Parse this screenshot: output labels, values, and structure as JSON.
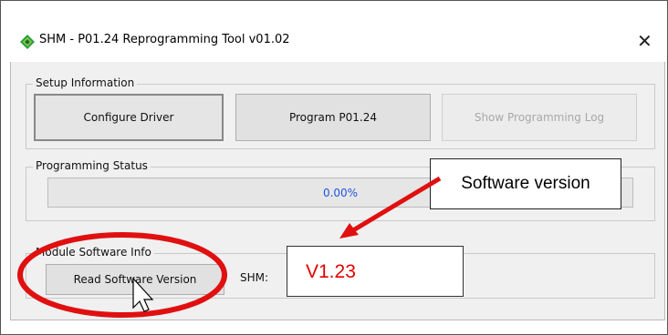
{
  "window": {
    "title": "SHM - P01.24 Reprogramming Tool v01.02",
    "close_glyph": "✕",
    "app_icon": "diamond-app-icon"
  },
  "setup": {
    "label": "Setup Information",
    "configure_label": "Configure Driver",
    "program_label": "Program P01.24",
    "show_log_label": "Show Programming Log"
  },
  "status": {
    "label": "Programming Status",
    "progress_text": "0.00%",
    "progress_fraction": 0
  },
  "module": {
    "label": "Module Software Info",
    "read_label": "Read Software Version",
    "shm_label": "SHM:",
    "value": "V1.23"
  },
  "annotation": {
    "callout_text": "Software version",
    "highlight_color": "#e01010",
    "arrow_color": "#e01010"
  },
  "cursor_icon": "mouse-pointer-icon"
}
